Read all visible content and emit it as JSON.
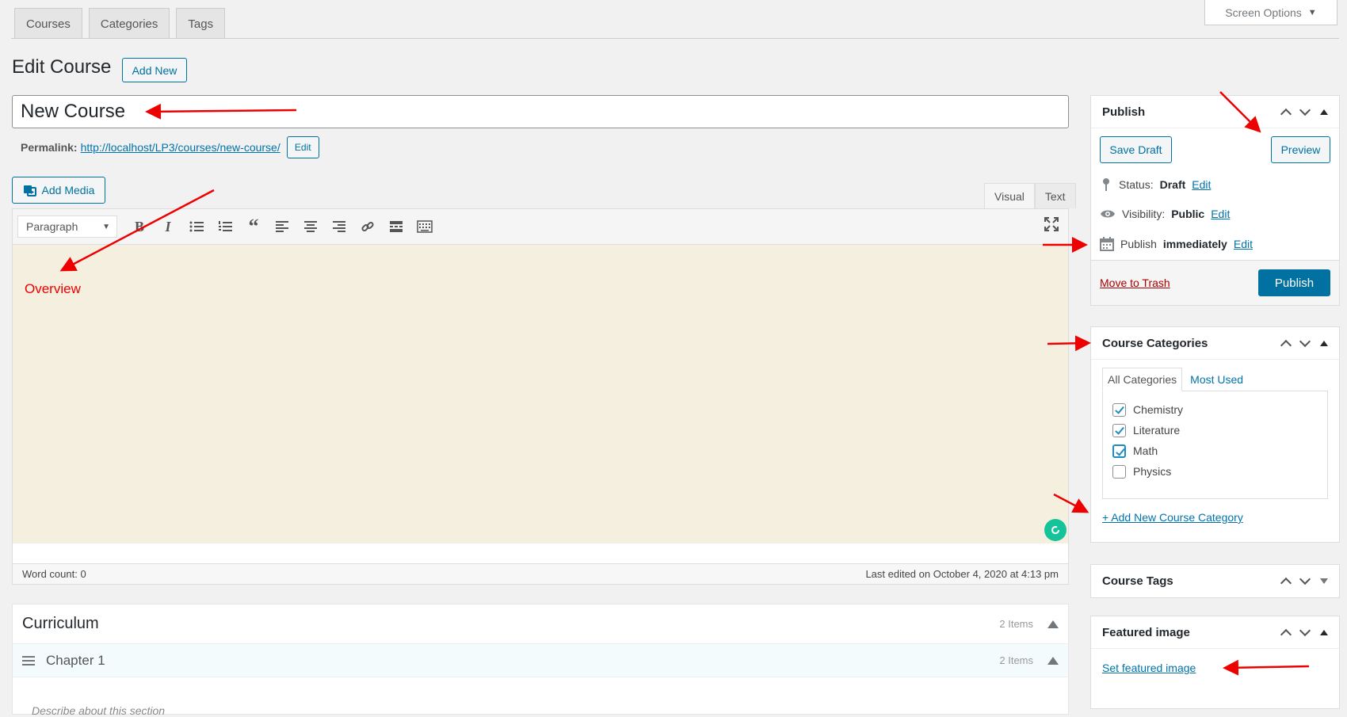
{
  "top_tabs": [
    "Courses",
    "Categories",
    "Tags"
  ],
  "screen_options": "Screen Options",
  "page_title": "Edit Course",
  "add_new": "Add New",
  "title_value": "New Course",
  "permalink": {
    "label": "Permalink:",
    "url": "http://localhost/LP3/courses/new-course/",
    "edit": "Edit"
  },
  "add_media": "Add Media",
  "editor_tabs": {
    "visual": "Visual",
    "text": "Text"
  },
  "format_select": "Paragraph",
  "toolbar_icons": [
    "bold-icon",
    "italic-icon",
    "bullet-list-icon",
    "numbered-list-icon",
    "blockquote-icon",
    "align-left-icon",
    "align-center-icon",
    "align-right-icon",
    "link-icon",
    "read-more-icon",
    "toolbar-toggle-icon",
    "fullscreen-icon"
  ],
  "annotation_text": "Overview",
  "status_bar": {
    "word_count": "Word count: 0",
    "last_edited": "Last edited on October 4, 2020 at 4:13 pm"
  },
  "curriculum": {
    "title": "Curriculum",
    "count": "2 Items",
    "chapter": {
      "title": "Chapter 1",
      "count": "2 Items",
      "placeholder": "Describe about this section"
    }
  },
  "publish": {
    "title": "Publish",
    "save_draft": "Save Draft",
    "preview": "Preview",
    "status_label": "Status:",
    "status_value": "Draft",
    "visibility_label": "Visibility:",
    "visibility_value": "Public",
    "publish_label": "Publish",
    "publish_value": "immediately",
    "edit": "Edit",
    "trash": "Move to Trash",
    "publish_btn": "Publish"
  },
  "categories": {
    "title": "Course Categories",
    "tab_all": "All Categories",
    "tab_used": "Most Used",
    "items": [
      {
        "label": "Chemistry",
        "checked": true
      },
      {
        "label": "Literature",
        "checked": true
      },
      {
        "label": "Math",
        "checked": true
      },
      {
        "label": "Physics",
        "checked": false
      }
    ],
    "add_new": "+ Add New Course Category"
  },
  "tags": {
    "title": "Course Tags"
  },
  "featured": {
    "title": "Featured image",
    "set": "Set featured image"
  },
  "colors": {
    "accent": "#0071a1",
    "annotation": "#ee0000",
    "editor_bg": "#f5efe0"
  }
}
